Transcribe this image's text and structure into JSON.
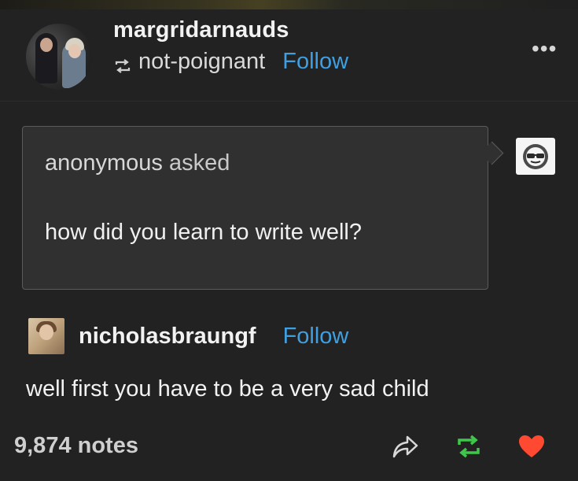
{
  "post": {
    "blog_name": "margridarnauds",
    "reblogged_from": "not-poignant",
    "follow_label": "Follow",
    "more_label": "•••"
  },
  "ask": {
    "asker": "anonymous",
    "asked_suffix": "asked",
    "question": "how did you learn to write well?",
    "answerer_icon": "cool-face-sunglasses-icon"
  },
  "reply": {
    "name": "nicholasbraungf",
    "follow_label": "Follow",
    "text": "well first you have to be a very sad child"
  },
  "footer": {
    "notes": "9,874 notes",
    "share_icon": "share-arrow-icon",
    "reblog_icon": "reblog-icon",
    "like_icon": "heart-icon"
  },
  "colors": {
    "background": "#222222",
    "link": "#3f9fe0",
    "reblog_green": "#3ec74a",
    "like_red": "#ff4930",
    "ask_box": "#303030"
  }
}
